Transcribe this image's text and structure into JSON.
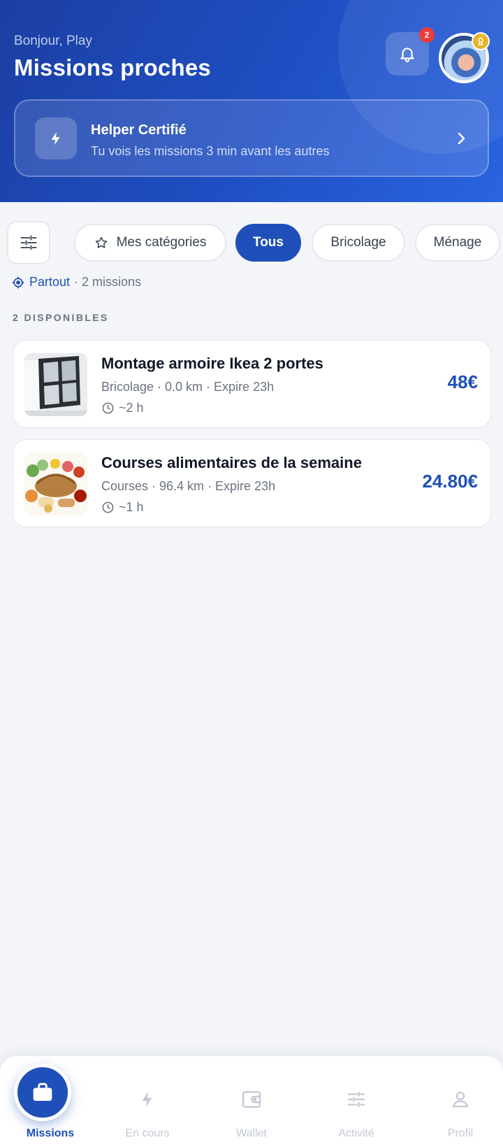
{
  "header": {
    "greeting": "Bonjour, Play",
    "title": "Missions proches",
    "notifications_count": "2",
    "icons": {
      "bell": "bell-icon",
      "avatar_badge": "medal-icon"
    }
  },
  "certified_banner": {
    "title": "Helper Certifié",
    "subtitle": "Tu vois les missions 3 min avant les autres",
    "icon": "lightning-icon"
  },
  "filters": {
    "chips": [
      {
        "label": "Mes catégories",
        "icon": "star-icon"
      },
      {
        "label": "Tous",
        "active": true
      },
      {
        "label": "Bricolage"
      },
      {
        "label": "Ménage"
      }
    ]
  },
  "location": {
    "label": "Partout",
    "count": "· 2 missions"
  },
  "section": {
    "label": "2 DISPONIBLES"
  },
  "missions": [
    {
      "title": "Montage armoire Ikea 2 portes",
      "meta": "Bricolage · 0.0 km · Expire 23h",
      "duration": "~2 h",
      "price": "48€"
    },
    {
      "title": "Courses alimentaires de la semaine",
      "meta": "Courses · 96.4 km · Expire 23h",
      "duration": "~1 h",
      "price": "24.80€"
    }
  ],
  "nav": {
    "items": [
      {
        "label": "Missions",
        "icon": "briefcase-icon",
        "active": true
      },
      {
        "label": "En cours",
        "icon": "lightning-icon"
      },
      {
        "label": "Wallet",
        "icon": "wallet-icon"
      },
      {
        "label": "Activité",
        "icon": "sliders-icon"
      },
      {
        "label": "Profil",
        "icon": "user-icon"
      }
    ]
  },
  "colors": {
    "primary": "#1f4fb8",
    "header_gradient_start": "#1b3fa3",
    "header_gradient_end": "#2a64e0",
    "badge_red": "#ef3b3b",
    "background": "#f3f5f9"
  }
}
